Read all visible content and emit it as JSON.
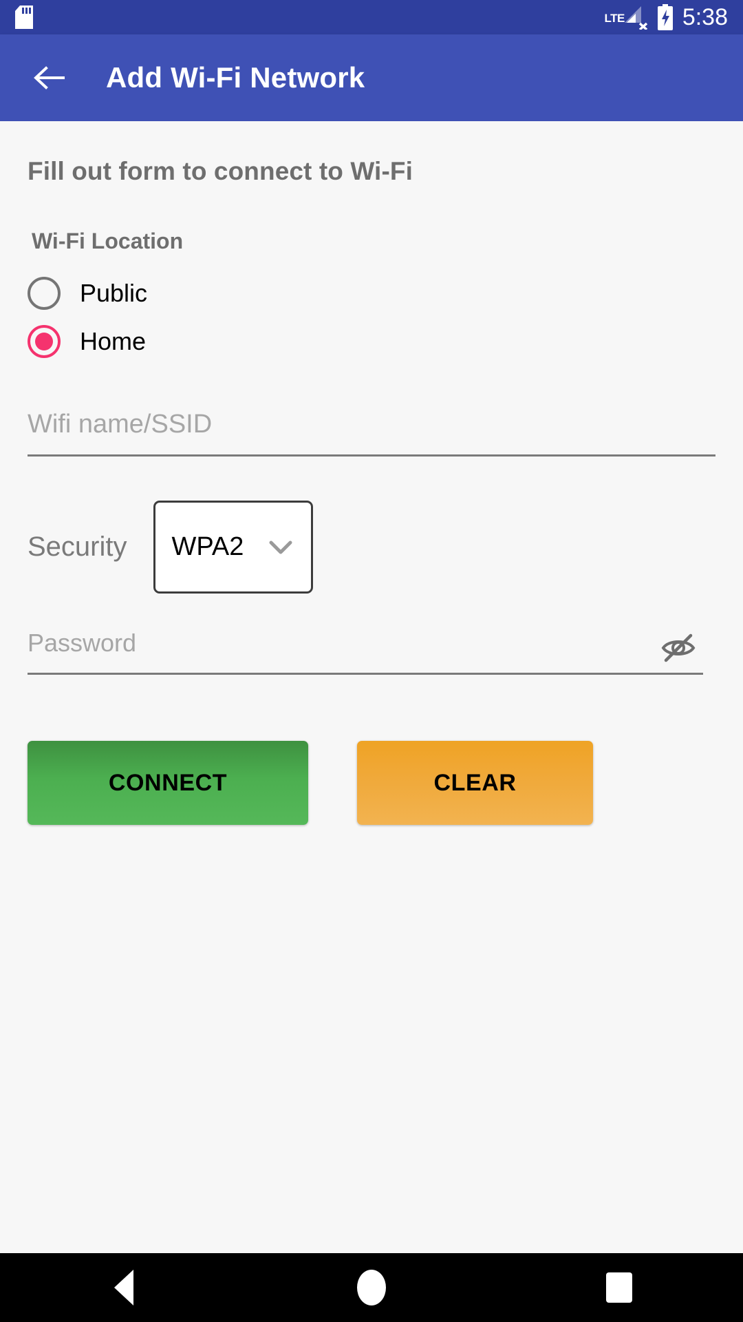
{
  "status_bar": {
    "sd_icon": "sd-card-icon",
    "network_label": "LTE",
    "signal_icon": "signal-no-service-icon",
    "battery_icon": "battery-charging-icon",
    "time": "5:38",
    "background_color": "#2f3f9e"
  },
  "app_bar": {
    "back_icon": "arrow-back-icon",
    "title": "Add Wi-Fi Network",
    "background_color": "#3f51b5"
  },
  "form": {
    "heading": "Fill out form to connect to Wi-Fi",
    "location": {
      "label": "Wi-Fi Location",
      "selected": "Home",
      "accent_color": "#f5336e",
      "options": [
        {
          "label": "Public",
          "checked": false
        },
        {
          "label": "Home",
          "checked": true
        }
      ]
    },
    "ssid": {
      "placeholder": "Wifi name/SSID",
      "value": ""
    },
    "security": {
      "label": "Security",
      "selected": "WPA2",
      "chevron_icon": "chevron-down-icon"
    },
    "password": {
      "placeholder": "Password",
      "value": "",
      "toggle_icon": "eye-off-icon"
    },
    "buttons": {
      "connect": {
        "label": "CONNECT",
        "color": "#4caf50"
      },
      "clear": {
        "label": "CLEAR",
        "color": "#f0a93a"
      }
    }
  },
  "nav_bar": {
    "back": "back-triangle-icon",
    "home": "home-circle-icon",
    "recents": "recents-square-icon"
  }
}
